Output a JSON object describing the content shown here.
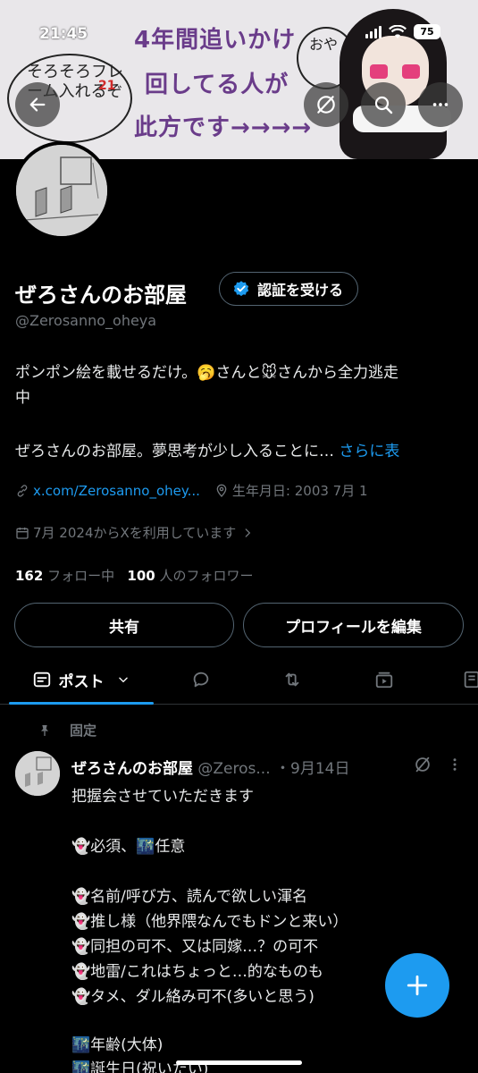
{
  "status": {
    "time": "21:45",
    "battery": "75"
  },
  "banner": {
    "line1": "4年間追いかけ",
    "line2": "回してる人が",
    "line3": "此方です→→→→",
    "bubble_left": "そろそろフレーム入れるぞ",
    "bubble_left_red": "21",
    "bubble_right": "おや"
  },
  "profile": {
    "display_name": "ぜろさんのお部屋",
    "verify_label": "認証を受ける",
    "handle": "@Zerosanno_oheya",
    "bio_line1": "ポンポン絵を載せるだけ。🥱さんと🐭さんから全力逃走",
    "bio_line2": "中",
    "bio_line3": "ぜろさんのお部屋。夢思考が少し入ることに…",
    "bio_more": "さらに表",
    "link": "x.com/Zerosanno_ohey...",
    "birthday": "生年月日: 2003 7月 1",
    "joined": "7月 2024からXを利用しています",
    "following_count": "162",
    "following_label": "フォロー中",
    "followers_count": "100",
    "followers_label": "人のフォロワー"
  },
  "actions": {
    "share": "共有",
    "edit": "プロフィールを編集"
  },
  "tabs": {
    "posts": "ポスト"
  },
  "post": {
    "pinned": "固定",
    "author": "ぜろさんのお部屋",
    "handle": "@Zeros...",
    "date": "・9月14日",
    "lines": [
      "把握会させていただきます",
      "",
      "👻必須、🌃任意",
      "",
      "👻名前/呼び方、読んで欲しい渾名",
      "👻推し様（他界隈なんでもドンと来い）",
      "👻同担の可不、又は同嫁…？の可不",
      "👻地雷/これはちょっと…的なものも",
      "👻タメ、ダル絡み可不(多いと思う)",
      "",
      "🌃年齢(大体)",
      "🌃誕生日(祝いたい)"
    ]
  },
  "colors": {
    "accent": "#1d9bf0",
    "background": "#000000",
    "muted": "#71767b"
  }
}
